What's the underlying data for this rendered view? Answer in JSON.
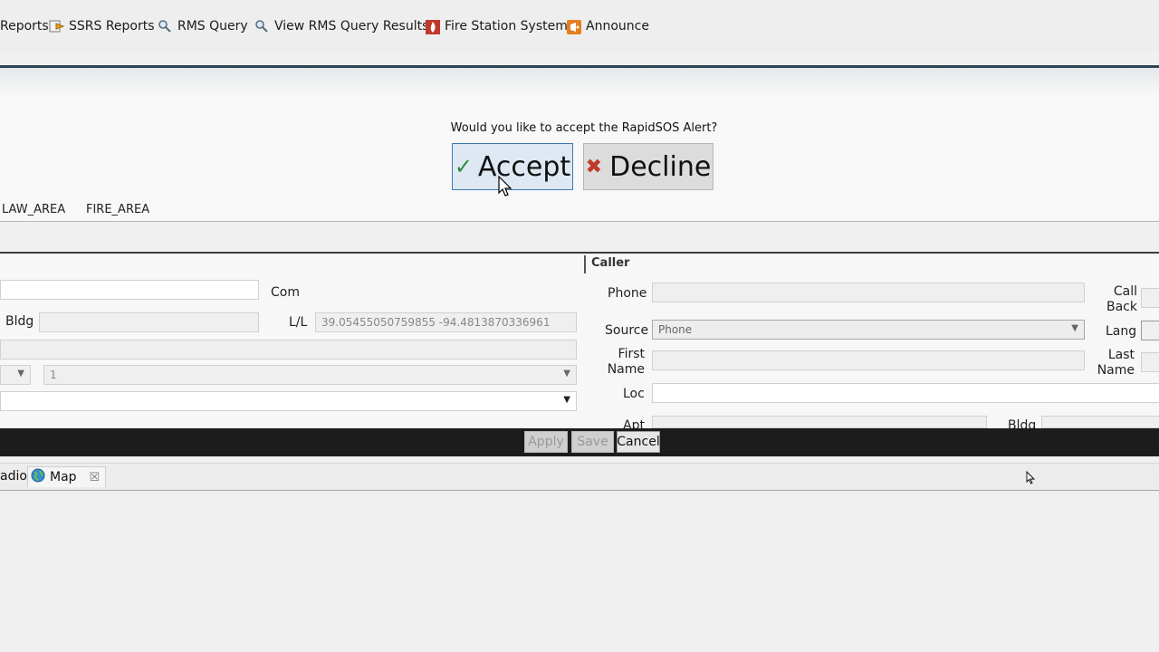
{
  "toolbar": {
    "items": [
      {
        "label": "Reports",
        "icon": "report-icon"
      },
      {
        "label": "SSRS Reports",
        "icon": "ssrs-report-icon"
      },
      {
        "label": "RMS Query",
        "icon": "magnifier-icon"
      },
      {
        "label": "View RMS Query Results",
        "icon": "magnifier-icon"
      },
      {
        "label": "Fire Station System",
        "icon": "fire-station-icon"
      },
      {
        "label": "Announce",
        "icon": "announce-icon"
      }
    ]
  },
  "alert": {
    "prompt": "Would you like to accept the RapidSOS Alert?",
    "accept_label": "Accept",
    "decline_label": "Decline"
  },
  "areas": {
    "law": "LAW_AREA",
    "fire": "FIRE_AREA"
  },
  "location": {
    "com_label": "Com",
    "bldg_label": "Bldg",
    "ll_label": "L/L",
    "ll_value": "39.05455050759855 -94.4813870336961",
    "dropdown_value": "1"
  },
  "caller": {
    "header": "Caller",
    "phone_label": "Phone",
    "callback_label": "Call Back",
    "source_label": "Source",
    "source_value": "Phone",
    "lang_label": "Lang",
    "first_name_label": "First Name",
    "last_name_label": "Last Name",
    "loc_label": "Loc",
    "apt_label": "Apt",
    "bldg_label": "Bldg"
  },
  "actions": {
    "apply_label": "Apply",
    "save_label": "Save",
    "cancel_label": "Cancel"
  },
  "tabs": {
    "radio_label": "adio",
    "map_label": "Map"
  },
  "colors": {
    "accent": "#3d7ab3",
    "accept_check": "#2b8a3e",
    "decline_x": "#c0392b",
    "action_bar": "#1c1c1c"
  }
}
